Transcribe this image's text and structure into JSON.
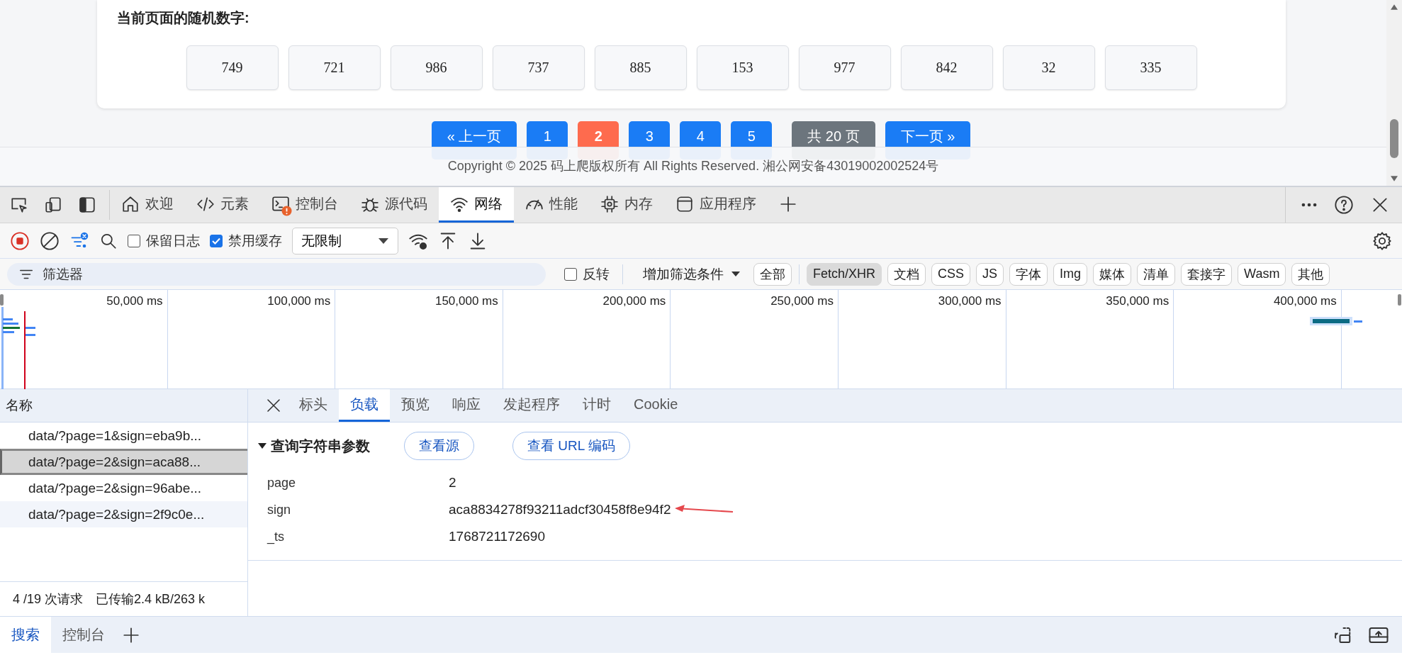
{
  "page": {
    "heading": "当前页面的随机数字:",
    "numbers": [
      "749",
      "721",
      "986",
      "737",
      "885",
      "153",
      "977",
      "842",
      "32",
      "335"
    ],
    "pagination": [
      {
        "label": "« 上一页",
        "kind": "nav"
      },
      {
        "label": "1",
        "kind": "page",
        "selected": false
      },
      {
        "label": "2",
        "kind": "page",
        "selected": true
      },
      {
        "label": "3",
        "kind": "page",
        "selected": false
      },
      {
        "label": "4",
        "kind": "page",
        "selected": false
      },
      {
        "label": "5",
        "kind": "page",
        "selected": false
      },
      {
        "label": "共 20 页",
        "kind": "info"
      },
      {
        "label": "下一页 »",
        "kind": "nav"
      }
    ],
    "footer": "Copyright © 2025 码上爬版权所有 All Rights Reserved. 湘公网安备43019002002524号"
  },
  "devtools": {
    "tabs": [
      {
        "label": "欢迎",
        "kind": "home",
        "selected": false,
        "warning": false
      },
      {
        "label": "元素",
        "kind": "code",
        "selected": false,
        "warning": false
      },
      {
        "label": "控制台",
        "kind": "console",
        "selected": false,
        "warning": true
      },
      {
        "label": "源代码",
        "kind": "bug",
        "selected": false,
        "warning": false
      },
      {
        "label": "网络",
        "kind": "wifi",
        "selected": true,
        "warning": false
      },
      {
        "label": "性能",
        "kind": "gauge",
        "selected": false,
        "warning": false
      },
      {
        "label": "内存",
        "kind": "chip",
        "selected": false,
        "warning": false
      },
      {
        "label": "应用程序",
        "kind": "app",
        "selected": false,
        "warning": false
      }
    ],
    "toolbar": {
      "recording": true,
      "preserve_log": {
        "label": "保留日志",
        "checked": false
      },
      "disable_cache": {
        "label": "禁用缓存",
        "checked": true
      },
      "throttle": "无限制"
    },
    "filter": {
      "placeholder": "筛选器",
      "invert": {
        "label": "反转",
        "checked": false
      },
      "more_filters": "增加筛选条件",
      "types": [
        {
          "label": "全部",
          "selected": false
        },
        {
          "label": "Fetch/XHR",
          "selected": true
        },
        {
          "label": "文档",
          "selected": false
        },
        {
          "label": "CSS",
          "selected": false
        },
        {
          "label": "JS",
          "selected": false
        },
        {
          "label": "字体",
          "selected": false
        },
        {
          "label": "Img",
          "selected": false
        },
        {
          "label": "媒体",
          "selected": false
        },
        {
          "label": "清单",
          "selected": false
        },
        {
          "label": "套接字",
          "selected": false
        },
        {
          "label": "Wasm",
          "selected": false
        },
        {
          "label": "其他",
          "selected": false
        }
      ]
    },
    "timeline": {
      "ticks": [
        "50,000 ms",
        "100,000 ms",
        "150,000 ms",
        "200,000 ms",
        "250,000 ms",
        "300,000 ms",
        "350,000 ms",
        "400,000 ms"
      ]
    },
    "requests": {
      "column": "名称",
      "rows": [
        {
          "name": "data/?page=1&sign=eba9b...",
          "selected": false
        },
        {
          "name": "data/?page=2&sign=aca88...",
          "selected": true
        },
        {
          "name": "data/?page=2&sign=96abe...",
          "selected": false
        },
        {
          "name": "data/?page=2&sign=2f9c0e...",
          "selected": false
        }
      ]
    },
    "detail_tabs": [
      {
        "label": "标头",
        "selected": false
      },
      {
        "label": "负载",
        "selected": true
      },
      {
        "label": "预览",
        "selected": false
      },
      {
        "label": "响应",
        "selected": false
      },
      {
        "label": "发起程序",
        "selected": false
      },
      {
        "label": "计时",
        "selected": false
      },
      {
        "label": "Cookie",
        "selected": false
      }
    ],
    "payload": {
      "section": "查询字符串参数",
      "expanded": true,
      "buttons": [
        "查看源",
        "查看 URL 编码"
      ],
      "params": [
        {
          "key": "page",
          "value": "2",
          "marked": false
        },
        {
          "key": "sign",
          "value": "aca8834278f93211adcf30458f8e94f2",
          "marked": true
        },
        {
          "key": "_ts",
          "value": "1768721172690",
          "marked": false
        }
      ]
    },
    "status": {
      "requests": "4 /19 次请求",
      "transferred": "已传输2.4 kB/263 k"
    },
    "drawer_tabs": [
      {
        "label": "搜索",
        "selected": true
      },
      {
        "label": "控制台",
        "selected": false
      }
    ]
  }
}
